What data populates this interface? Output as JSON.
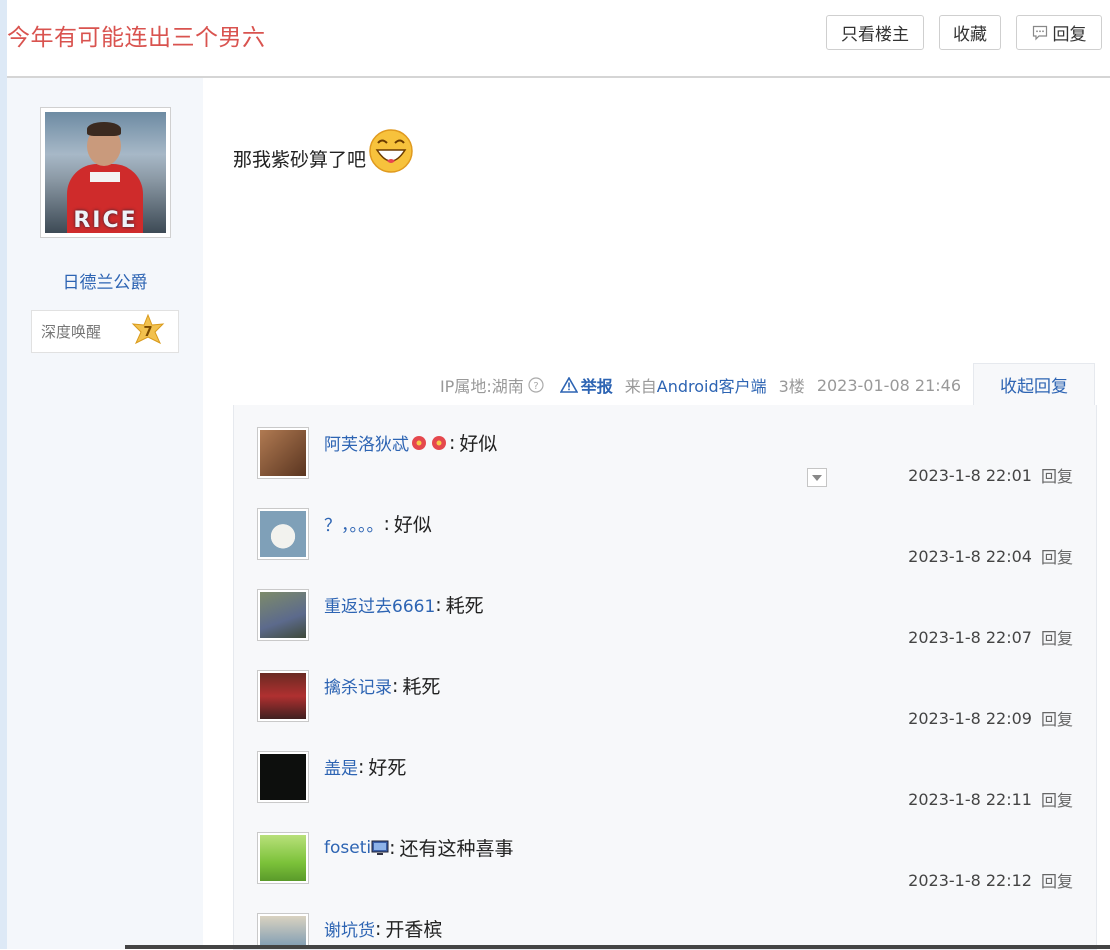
{
  "thread": {
    "title": "今年有可能连出三个男六"
  },
  "toolbar": {
    "lz_only": "只看楼主",
    "favorite": "收藏",
    "reply": "回复"
  },
  "author": {
    "name": "日德兰公爵",
    "avatar_text": "RICE",
    "level_name": "深度唤醒",
    "level": "7"
  },
  "post": {
    "content": "那我紫砂算了吧",
    "ip_location": "IP属地:湖南",
    "report": "举报",
    "source_prefix": "来自",
    "source_client": "Android客户端",
    "floor": "3楼",
    "time": "2023-01-08 21:46",
    "collapse_label": "收起回复"
  },
  "replies": [
    {
      "user": "阿芙洛狄忒",
      "text": "好似",
      "time": "2023-1-8 22:01",
      "action": "回复",
      "avatar_color": "#8a5a3c"
    },
    {
      "user": "？，。。。",
      "text": "好似",
      "time": "2023-1-8 22:04",
      "action": "回复",
      "avatar_color": "#7fa0b8"
    },
    {
      "user": "重返过去6661",
      "text": "耗死",
      "time": "2023-1-8 22:07",
      "action": "回复",
      "avatar_color": "#6b7b5a"
    },
    {
      "user": "擒杀记录",
      "text": "耗死",
      "time": "2023-1-8 22:09",
      "action": "回复",
      "avatar_color": "#9b2b2b"
    },
    {
      "user": "盖是",
      "text": "好死",
      "time": "2023-1-8 22:11",
      "action": "回复",
      "avatar_color": "#111111"
    },
    {
      "user": "foseti",
      "text": "还有这种喜事",
      "time": "2023-1-8 22:12",
      "action": "回复",
      "avatar_color": "#8fcf3a"
    },
    {
      "user": "谢坑货",
      "text": "开香槟",
      "time": "",
      "action": "",
      "avatar_color": "#8aa3b5"
    }
  ],
  "colors": {
    "title": "#d9534f",
    "link": "#2d64b3",
    "sidebar_bg": "#f4f7fb",
    "reply_bg": "#f7f8fa"
  }
}
